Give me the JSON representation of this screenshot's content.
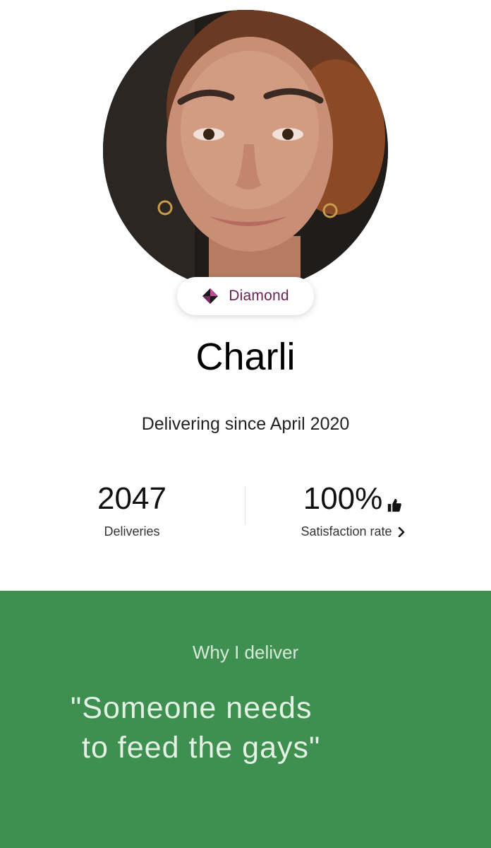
{
  "profile": {
    "name": "Charli",
    "badge_label": "Diamond",
    "since": "Delivering since April 2020",
    "badge_color": "#6b2352"
  },
  "stats": {
    "deliveries_value": "2047",
    "deliveries_label": "Deliveries",
    "satisfaction_value": "100%",
    "satisfaction_label": "Satisfaction rate"
  },
  "why": {
    "heading": "Why I deliver",
    "quote_line1": "\"Someone needs",
    "quote_line2": "to feed the gays\"",
    "background": "#3f9050"
  },
  "icons": {
    "badge": "diamond-icon",
    "satisfaction": "thumbs-up-icon",
    "chevron": "chevron-right-icon"
  }
}
